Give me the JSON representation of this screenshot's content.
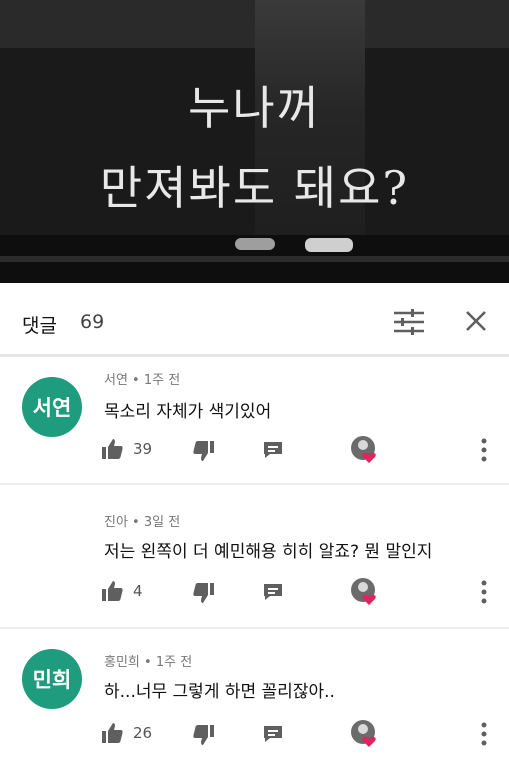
{
  "video": {
    "caption_line1": "누나꺼",
    "caption_line2": "만져봐도 돼요?"
  },
  "header": {
    "title": "댓글",
    "count": "69",
    "sort_icon": "sort-sliders-icon",
    "close_icon": "close-icon"
  },
  "comments": [
    {
      "avatar_text": "서연",
      "author": "서연",
      "time": "1주 전",
      "text": "목소리 자체가 색기있어",
      "likes": "39",
      "has_avatar": true
    },
    {
      "avatar_text": "",
      "author": "진아",
      "time": "3일 전",
      "text": "저는 왼쪽이 더 예민해용 히히 알죠? 뭔 말인지",
      "likes": "4",
      "has_avatar": false
    },
    {
      "avatar_text": "민희",
      "author": "홍민희",
      "time": "1주 전",
      "text": "하...너무 그렇게 하면 꼴리잖아..",
      "likes": "26",
      "has_avatar": true
    }
  ],
  "meta_separator": " • ",
  "colors": {
    "avatar_bg": "#1f9b7d",
    "heart": "#e0245e",
    "icon_gray": "#5f5f5f"
  }
}
